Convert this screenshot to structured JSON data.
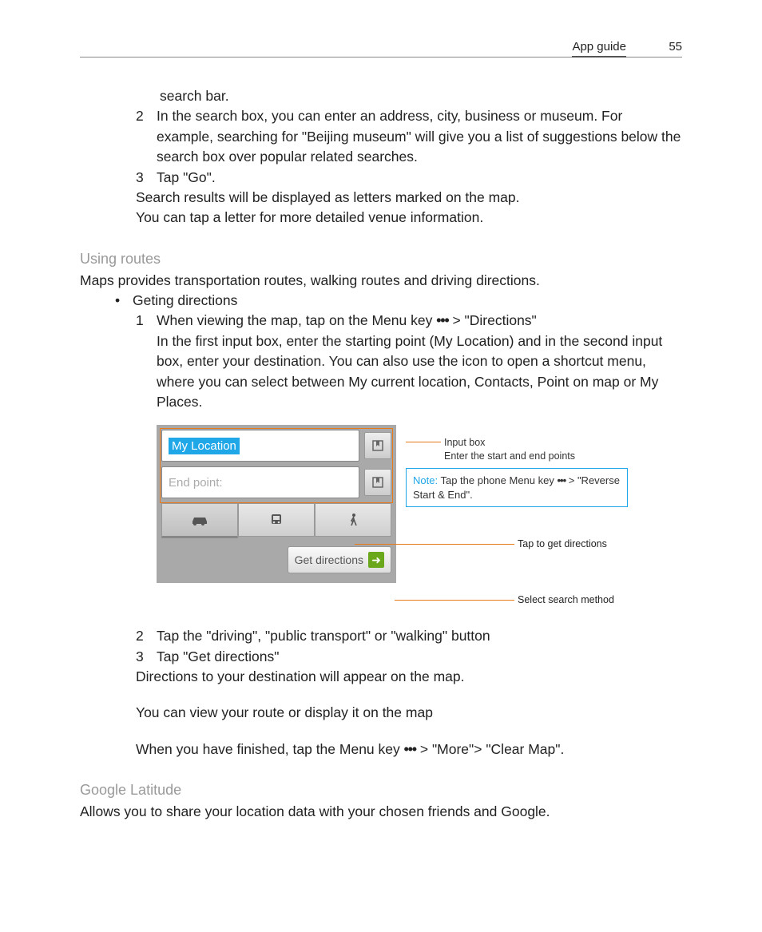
{
  "header": {
    "title": "App guide",
    "page": "55"
  },
  "top": {
    "cont": "search bar.",
    "n2": "2",
    "t2": "In the search box, you can enter an address, city, business or museum. For example, searching for \"Beijing museum\" will give you a list of suggestions below the search box over popular related searches.",
    "n3": "3",
    "t3": "Tap \"Go\".",
    "after1": "Search results will be displayed as letters marked on the map.",
    "after2": "You can tap a letter for more detailed venue information."
  },
  "routes": {
    "h": "Using routes",
    "intro": "Maps provides transportation routes, walking routes and driving directions.",
    "bullet": "Geting directions",
    "n1": "1",
    "t1a": "When viewing the map, tap on the Menu key ",
    "t1b": " > \"Directions\"",
    "t1c": "In the first input box, enter the starting point (My Location) and in the second input box, enter your destination. You can also use the icon to open a shortcut menu, where you can select between My current location, Contacts, Point on map or My Places."
  },
  "fig": {
    "myloc": "My Location",
    "end": "End point:",
    "getdir": "Get directions",
    "c1a": "Input box",
    "c1b": "Enter the start and end points",
    "noteLabel": "Note:",
    "noteA": "Tap the phone Menu key ",
    "noteB": " > \"Reverse Start & End\".",
    "c2": "Tap to get directions",
    "c3": "Select search method"
  },
  "after": {
    "n2": "2",
    "t2": "Tap the \"driving\", \"public transport\" or \"walking\" button",
    "n3": "3",
    "t3": "Tap \"Get directions\"",
    "l1": "Directions to your destination will appear on the map.",
    "l2": "You can view your route or display it on the map",
    "l3a": "When you have finished, tap the Menu key ",
    "l3b": " > \"More\"> \"Clear Map\"."
  },
  "latitude": {
    "h": "Google Latitude",
    "t": "Allows you to share your location data with your chosen friends and Google."
  }
}
